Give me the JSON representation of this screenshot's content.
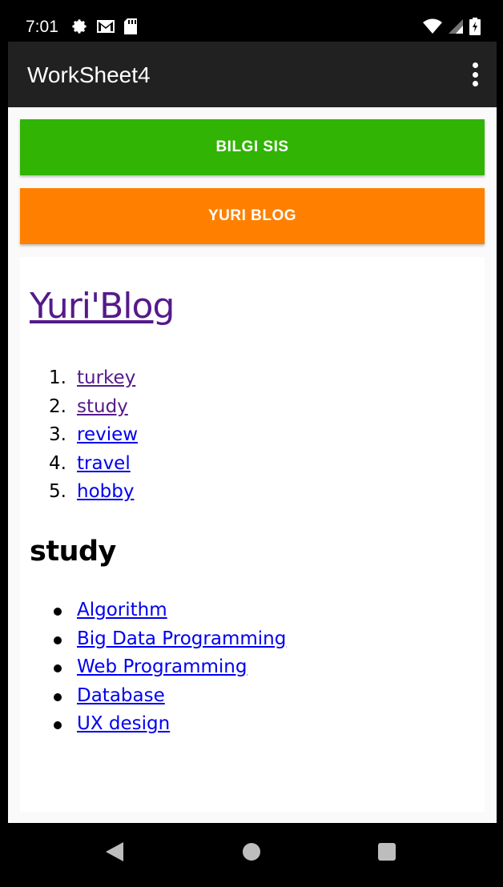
{
  "status_bar": {
    "time": "7:01",
    "left_icons": [
      "gear-icon",
      "gmail-icon",
      "sd-card-icon"
    ],
    "right_icons": [
      "wifi-icon",
      "signal-icon",
      "battery-charging-icon"
    ]
  },
  "app_bar": {
    "title": "WorkSheet4",
    "overflow_icon": "more-vert-icon"
  },
  "buttons": {
    "bilgi_sis": {
      "label": "BILGI SIS",
      "color": "#31b404"
    },
    "yuri_blog": {
      "label": "YURI BLOG",
      "color": "#ff8000"
    }
  },
  "webview": {
    "title": "Yuri'Blog",
    "categories": [
      {
        "num": "1.",
        "label": "turkey",
        "visited": true
      },
      {
        "num": "2.",
        "label": "study",
        "visited": true
      },
      {
        "num": "3.",
        "label": "review",
        "visited": false
      },
      {
        "num": "4.",
        "label": "travel",
        "visited": false
      },
      {
        "num": "5.",
        "label": "hobby",
        "visited": false
      }
    ],
    "section_title": "study",
    "study_items": [
      "Algorithm",
      "Big Data Programming",
      "Web Programming",
      "Database",
      "UX design"
    ],
    "link_color": "#0000ee",
    "visited_color": "#551a8b"
  },
  "nav_bar": {
    "icons": [
      "back-icon",
      "home-icon",
      "recents-icon"
    ]
  }
}
